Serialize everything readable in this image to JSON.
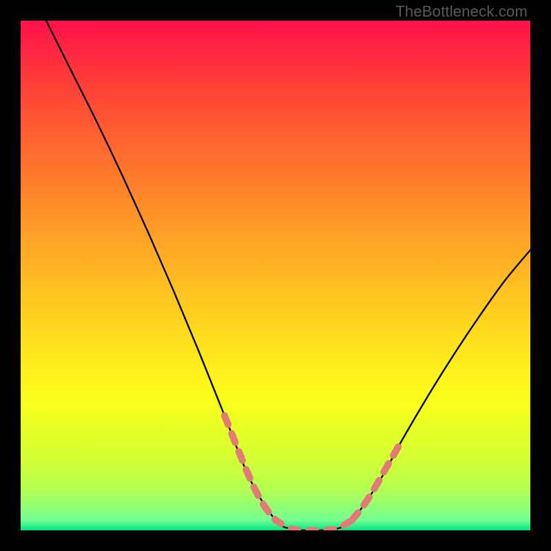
{
  "watermark": "TheBottleneck.com",
  "chart_data": {
    "type": "line",
    "title": "",
    "xlabel": "",
    "ylabel": "",
    "xlim": [
      0,
      100
    ],
    "ylim": [
      0,
      100
    ],
    "series": [
      {
        "name": "bottleneck-curve",
        "x": [
          5,
          10,
          15,
          20,
          25,
          30,
          35,
          40,
          45,
          50,
          53,
          56,
          59,
          62,
          65,
          70,
          75,
          80,
          85,
          90,
          95,
          100
        ],
        "values": [
          100,
          90,
          80,
          69.5,
          58.5,
          47,
          35,
          22.5,
          10,
          2,
          0.3,
          0,
          0,
          0.3,
          2,
          9,
          18,
          26.5,
          34.5,
          42,
          49,
          55
        ]
      }
    ],
    "highlight_segments": [
      {
        "name": "left-branch-highlight",
        "x": [
          40,
          42,
          44,
          46,
          48,
          50
        ],
        "values": [
          22.5,
          17.5,
          12.5,
          8,
          4.5,
          2
        ]
      },
      {
        "name": "right-branch-highlight",
        "x": [
          65,
          67,
          69,
          71,
          73,
          75
        ],
        "values": [
          2,
          4.5,
          7.5,
          11,
          14.5,
          18
        ]
      },
      {
        "name": "trough-highlight",
        "x": [
          50,
          53,
          56,
          59,
          62,
          65
        ],
        "values": [
          2,
          0.3,
          0,
          0,
          0.3,
          2
        ]
      }
    ]
  }
}
